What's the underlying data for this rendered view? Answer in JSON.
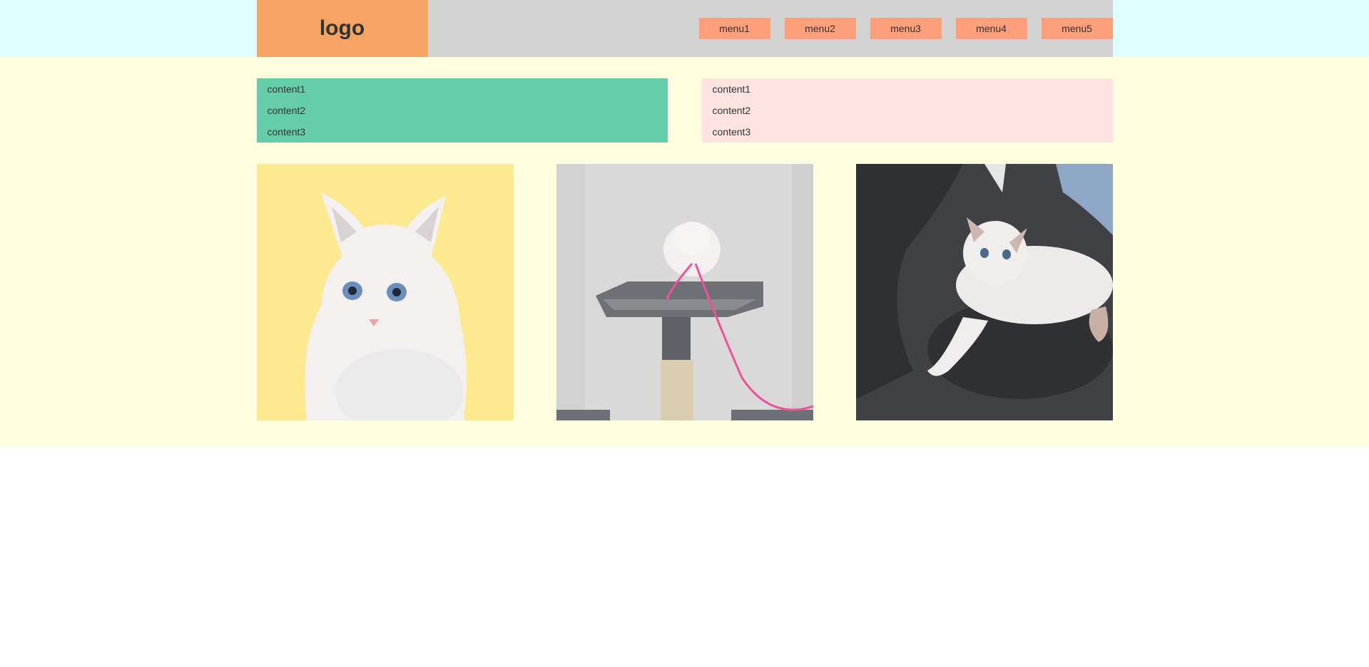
{
  "header": {
    "logo": "logo",
    "menu": [
      "menu1",
      "menu2",
      "menu3",
      "menu4",
      "menu5"
    ]
  },
  "content_boxes": [
    {
      "color": "#66cdaa",
      "items": [
        "content1",
        "content2",
        "content3"
      ]
    },
    {
      "color": "#ffe4e1",
      "items": [
        "content1",
        "content2",
        "content3"
      ]
    }
  ],
  "photos": [
    {
      "name": "white kitten on yellow background"
    },
    {
      "name": "kitten on cat tree with pink string"
    },
    {
      "name": "kitten lying on dark cushion"
    }
  ],
  "colors": {
    "header_bg": "#dfffff",
    "header_inner": "#d3d3d3",
    "logo_bg": "#f4a460",
    "menu_bg": "#ffa07a",
    "main_bg": "#ffffe0"
  }
}
